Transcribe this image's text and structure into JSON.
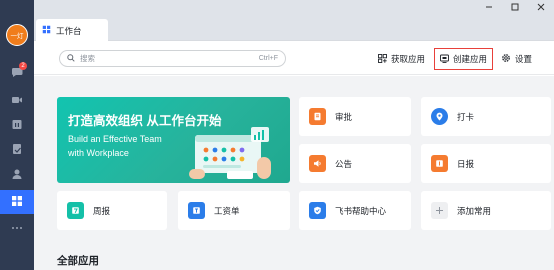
{
  "sidebar": {
    "avatar_text": "一灯",
    "badge": "2",
    "items": [
      {
        "icon": "chat-icon"
      },
      {
        "icon": "video-icon"
      },
      {
        "icon": "calendar-icon"
      },
      {
        "icon": "docs-icon"
      },
      {
        "icon": "contacts-icon"
      },
      {
        "icon": "workplace-icon"
      },
      {
        "icon": "more-icon"
      }
    ],
    "active_color": "#3370ff",
    "bg_color": "#2f3b52"
  },
  "window": {
    "buttons": [
      "minimize-icon",
      "maximize-icon",
      "close-icon"
    ]
  },
  "tab": {
    "label": "工作台"
  },
  "header": {
    "search_placeholder": "搜索",
    "search_shortcut": "Ctrl+F",
    "get_apps": "获取应用",
    "create_app": "创建应用",
    "settings": "设置"
  },
  "banner": {
    "title": "打造高效组织 从工作台开始",
    "subtitle_line1": "Build an Effective Team",
    "subtitle_line2": "with Workplace",
    "color": "#12c4b0"
  },
  "apps": [
    {
      "label": "审批",
      "icon": "approval-icon",
      "color": "#f57b30"
    },
    {
      "label": "打卡",
      "icon": "location-pin-icon",
      "color": "#2b7de9"
    },
    {
      "label": "公告",
      "icon": "megaphone-icon",
      "color": "#f57b30"
    },
    {
      "label": "日报",
      "icon": "daily-report-icon",
      "color": "#f57b30"
    },
    {
      "label": "周报",
      "icon": "weekly-report-icon",
      "color": "#14c0a8"
    },
    {
      "label": "工资单",
      "icon": "payslip-icon",
      "color": "#2b7de9"
    },
    {
      "label": "飞书帮助中心",
      "icon": "help-center-icon",
      "color": "#2b7de9"
    },
    {
      "label": "添加常用",
      "icon": "plus-icon",
      "color": "#eeeff1"
    }
  ],
  "section": {
    "title": "全部应用"
  }
}
